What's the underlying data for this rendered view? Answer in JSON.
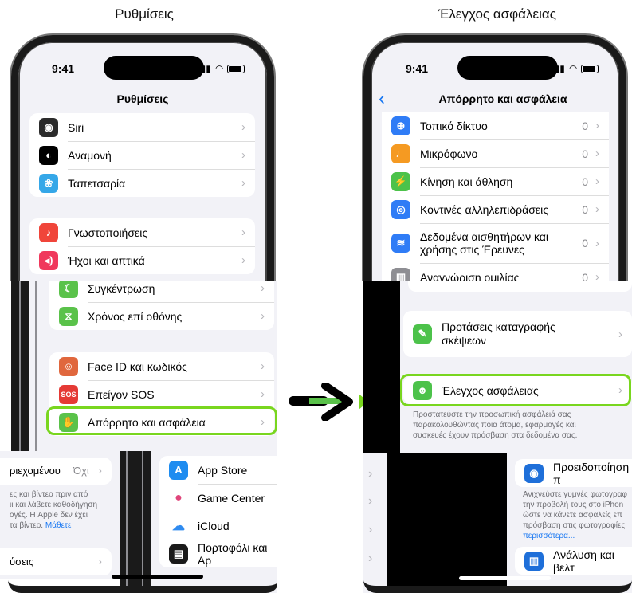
{
  "captions": {
    "left": "Ρυθμίσεις",
    "right": "Έλεγχος ασφάλειας"
  },
  "left_phone": {
    "time": "9:41",
    "title": "Ρυθμίσεις",
    "group1": [
      {
        "label": "Siri",
        "icon": "siri-icon",
        "color": "#2b2b2b"
      },
      {
        "label": "Αναμονή",
        "icon": "standby-icon",
        "color": "#000000"
      },
      {
        "label": "Ταπετσαρία",
        "icon": "wallpaper-icon",
        "color": "#35a7e8"
      }
    ],
    "group2": [
      {
        "label": "Γνωστοποιήσεις",
        "icon": "notifications-icon",
        "color": "#f0453a"
      },
      {
        "label": "Ήχοι και απτικά",
        "icon": "sounds-icon",
        "color": "#f0385c"
      }
    ],
    "group3": [
      {
        "label": "Συγκέντρωση",
        "icon": "focus-icon",
        "color": "#5ac24a"
      },
      {
        "label": "Χρόνος επί οθόνης",
        "icon": "screen-time-icon",
        "color": "#5ac24a"
      }
    ],
    "group4": [
      {
        "label": "Face ID και κωδικός",
        "icon": "face-id-icon",
        "color": "#e0673d"
      },
      {
        "label": "Επείγον SOS",
        "icon": "sos-icon",
        "color": "#e53a35",
        "glyph": "SOS"
      },
      {
        "label": "Απόρρητο και ασφάλεια",
        "icon": "hand-icon",
        "color": "#5ac24a"
      }
    ],
    "strip_left": {
      "content_label": "ριεχομένου",
      "content_value": "Όχι",
      "foot1": "ες και βίντεο πριν από",
      "foot2": "ιι και λάβετε καθοδήγηση",
      "foot3": "ογές. Η Apple δεν έχει",
      "foot4": "τα βίντεο. ",
      "foot_link": "Μάθετε",
      "bottom_label": "ύσεις"
    },
    "strip_right": [
      {
        "label": "App Store",
        "icon": "app-store-icon",
        "color": "#1e8cf0"
      },
      {
        "label": "Game Center",
        "icon": "game-center-icon",
        "color": "#ffffff"
      },
      {
        "label": "iCloud",
        "icon": "icloud-icon",
        "color": "#ffffff"
      },
      {
        "label": "Πορτοφόλι και Ap",
        "icon": "wallet-icon",
        "color": "#1a1a1a"
      }
    ]
  },
  "right_phone": {
    "time": "9:41",
    "title": "Απόρρητο και ασφάλεια",
    "back_icon": "back-chevron-icon",
    "rows": [
      {
        "label": "Τοπικό δίκτυο",
        "count": "0",
        "icon": "globe-icon",
        "color": "#2f7cf6"
      },
      {
        "label": "Μικρόφωνο",
        "count": "0",
        "icon": "microphone-icon",
        "color": "#f59a22"
      },
      {
        "label": "Κίνηση και άθληση",
        "count": "0",
        "icon": "motion-icon",
        "color": "#4cc24a"
      },
      {
        "label": "Κοντινές αλληλεπιδράσεις",
        "count": "0",
        "icon": "nearby-icon",
        "color": "#2f7cf6"
      },
      {
        "label1": "Δεδομένα αισθητήρων και",
        "label2": "χρήσης στις Έρευνες",
        "count": "0",
        "icon": "research-icon",
        "color": "#2f7cf6"
      },
      {
        "label": "Αναγνώριση ομιλίας",
        "count": "0",
        "icon": "speech-icon",
        "color": "#8e8e93"
      }
    ],
    "journal": {
      "label1": "Προτάσεις καταγραφής",
      "label2": "σκέψεων",
      "icon": "journal-icon",
      "color": "#4cc24a"
    },
    "safety": {
      "label": "Έλεγχος ασφάλειας",
      "icon": "safety-check-icon",
      "color": "#4cc24a",
      "foot1": "Προστατεύστε την προσωπική ασφάλειά σας",
      "foot2": "παρακολουθώντας ποια άτομα, εφαρμογές και",
      "foot3": "συσκευές έχουν πρόσβαση στα δεδομένα σας."
    },
    "warning": {
      "label": "Προειδοποίηση π",
      "icon": "eye-icon",
      "color": "#1e6fd9",
      "foot1": "Ανιχνεύστε γυμνές φωτογραφ",
      "foot2": "την προβολή τους στο iPhon",
      "foot3": "ώστε να κάνετε ασφαλείς επ",
      "foot4": "πρόσβαση στις φωτογραφίες",
      "foot_link": "περισσότερα..."
    },
    "analysis": {
      "label": "Ανάλυση και βελτ",
      "icon": "analytics-icon",
      "color": "#1e6fd9"
    }
  },
  "arrow_icon": "right-arrow-icon"
}
